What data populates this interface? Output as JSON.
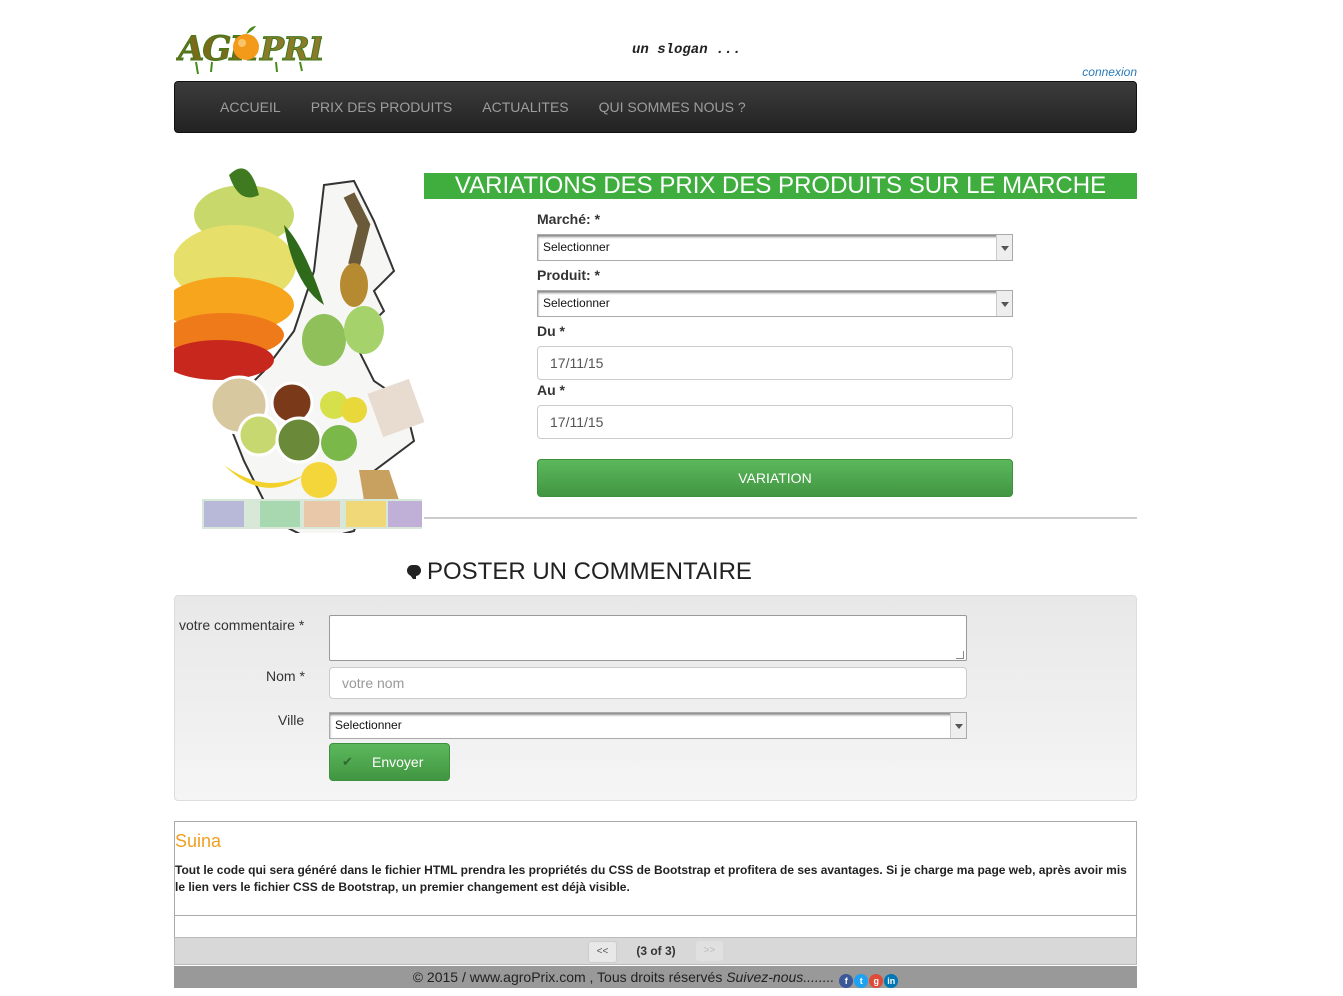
{
  "header": {
    "slogan": "un slogan ...",
    "connexion": "connexion",
    "logo_text_1": "AGR",
    "logo_text_2": "PRIX"
  },
  "nav": {
    "items": [
      {
        "label": "ACCUEIL"
      },
      {
        "label": "PRIX DES PRODUITS"
      },
      {
        "label": "ACTUALITES"
      },
      {
        "label": "QUI SOMMES NOUS ?"
      }
    ]
  },
  "variation": {
    "title": "VARIATIONS DES PRIX DES PRODUITS SUR LE MARCHE",
    "marche_label": "Marché: *",
    "marche_value": "Selectionner",
    "produit_label": "Produit: *",
    "produit_value": "Selectionner",
    "du_label": "Du *",
    "du_value": "17/11/15",
    "au_label": "Au *",
    "au_value": "17/11/15",
    "button": "VARIATION"
  },
  "comment_form": {
    "title": "POSTER UN COMMENTAIRE",
    "commentaire_label": "votre commentaire *",
    "nom_label": "Nom *",
    "nom_placeholder": "votre nom",
    "ville_label": "Ville",
    "ville_value": "Selectionner",
    "submit": "Envoyer"
  },
  "comments": {
    "author": "Suina",
    "text": "Tout le code qui sera généré dans le fichier HTML prendra les propriétés du CSS de Bootstrap et profitera de ses avantages. Si je charge ma page web, après avoir mis le lien vers le fichier CSS de Bootstrap, un premier changement est déjà visible.",
    "pager": {
      "prev": "<<",
      "status": "(3 of 3)",
      "next": ">>"
    }
  },
  "footer": {
    "copyright": "© 2015 / www.agroPrix.com , Tous droits réservés ",
    "follow": "Suivez-nous........",
    "social": [
      "facebook-icon",
      "twitter-icon",
      "google-plus-icon",
      "linkedin-icon"
    ]
  },
  "colors": {
    "title_green": "#3fae3f",
    "button_green": "#5cb85c",
    "navbar_dark": "#222222",
    "author_orange": "#f0a020",
    "link_blue": "#2a7ab8"
  }
}
